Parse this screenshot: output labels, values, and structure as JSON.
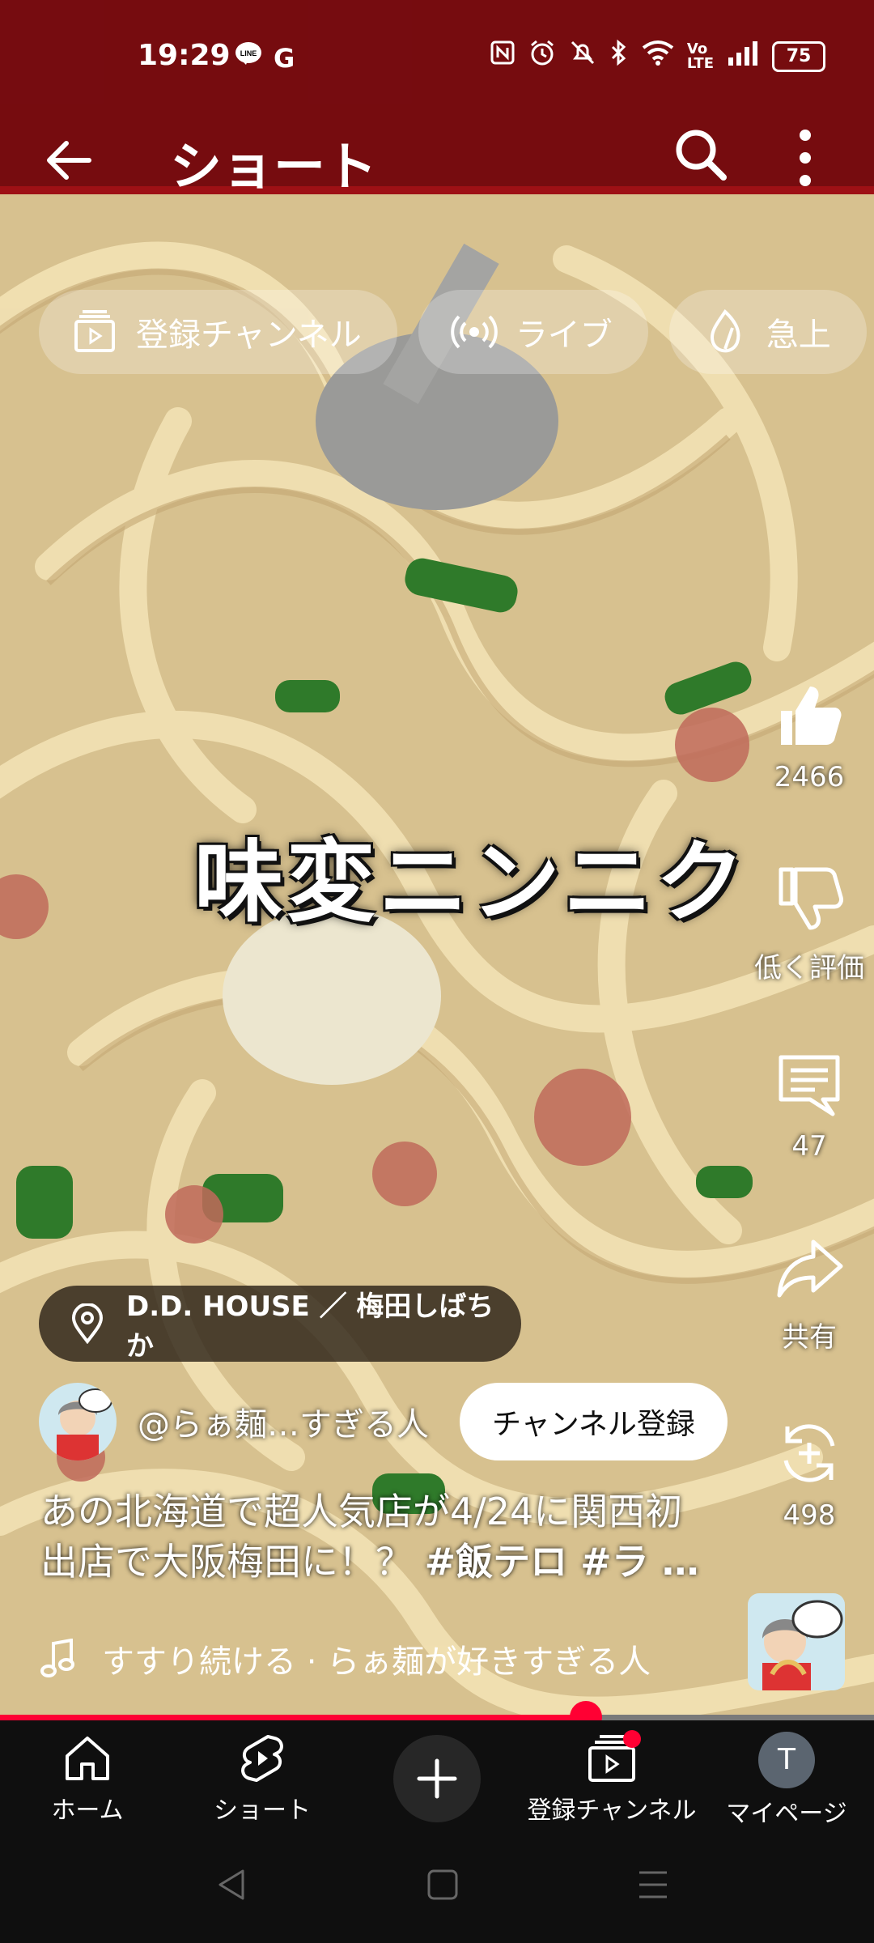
{
  "status_bar": {
    "time": "19:29",
    "left_icons": [
      "line-icon",
      "google-icon"
    ],
    "right_icons": [
      "nfc-icon",
      "alarm-icon",
      "mute-icon",
      "bluetooth-icon",
      "wifi-icon",
      "volte-icon",
      "signal-icon"
    ],
    "battery": "75"
  },
  "header": {
    "title": "ショート"
  },
  "chips": [
    {
      "label": "登録チャンネル",
      "icon": "subscriptions-icon"
    },
    {
      "label": "ライブ",
      "icon": "live-icon"
    },
    {
      "label": "急上",
      "icon": "trending-icon"
    }
  ],
  "video": {
    "overlay_text": "味変ニンニク"
  },
  "actions": {
    "like": {
      "label": "2466",
      "icon": "thumb-up-icon"
    },
    "dislike": {
      "label": "低く評価",
      "icon": "thumb-down-icon"
    },
    "comments": {
      "label": "47",
      "icon": "comment-icon"
    },
    "share": {
      "label": "共有",
      "icon": "share-icon"
    },
    "remix": {
      "label": "498",
      "icon": "remix-icon"
    }
  },
  "location": {
    "label": "D.D. HOUSE ／ 梅田しばちか",
    "icon": "location-pin-icon"
  },
  "channel": {
    "name": "@らぁ麺…すぎる人",
    "subscribe_label": "チャンネル登録"
  },
  "description": {
    "line1": "あの北海道で超人気店が4/24に関西初",
    "line2_plain": "出店で大阪梅田に！？ ",
    "line2_tags": "#飯テロ #ラ …"
  },
  "music": {
    "label": "すすり続ける · らぁ麺が好きすぎる人",
    "icon": "music-note-icon"
  },
  "progress": {
    "fraction": 0.67
  },
  "bottom_nav": {
    "home": "ホーム",
    "shorts": "ショート",
    "subscriptions": "登録チャンネル",
    "mypage": "マイページ",
    "mypage_initial": "T"
  },
  "colors": {
    "accent": "#ff0033",
    "nav_bg": "#0f0f0f"
  }
}
